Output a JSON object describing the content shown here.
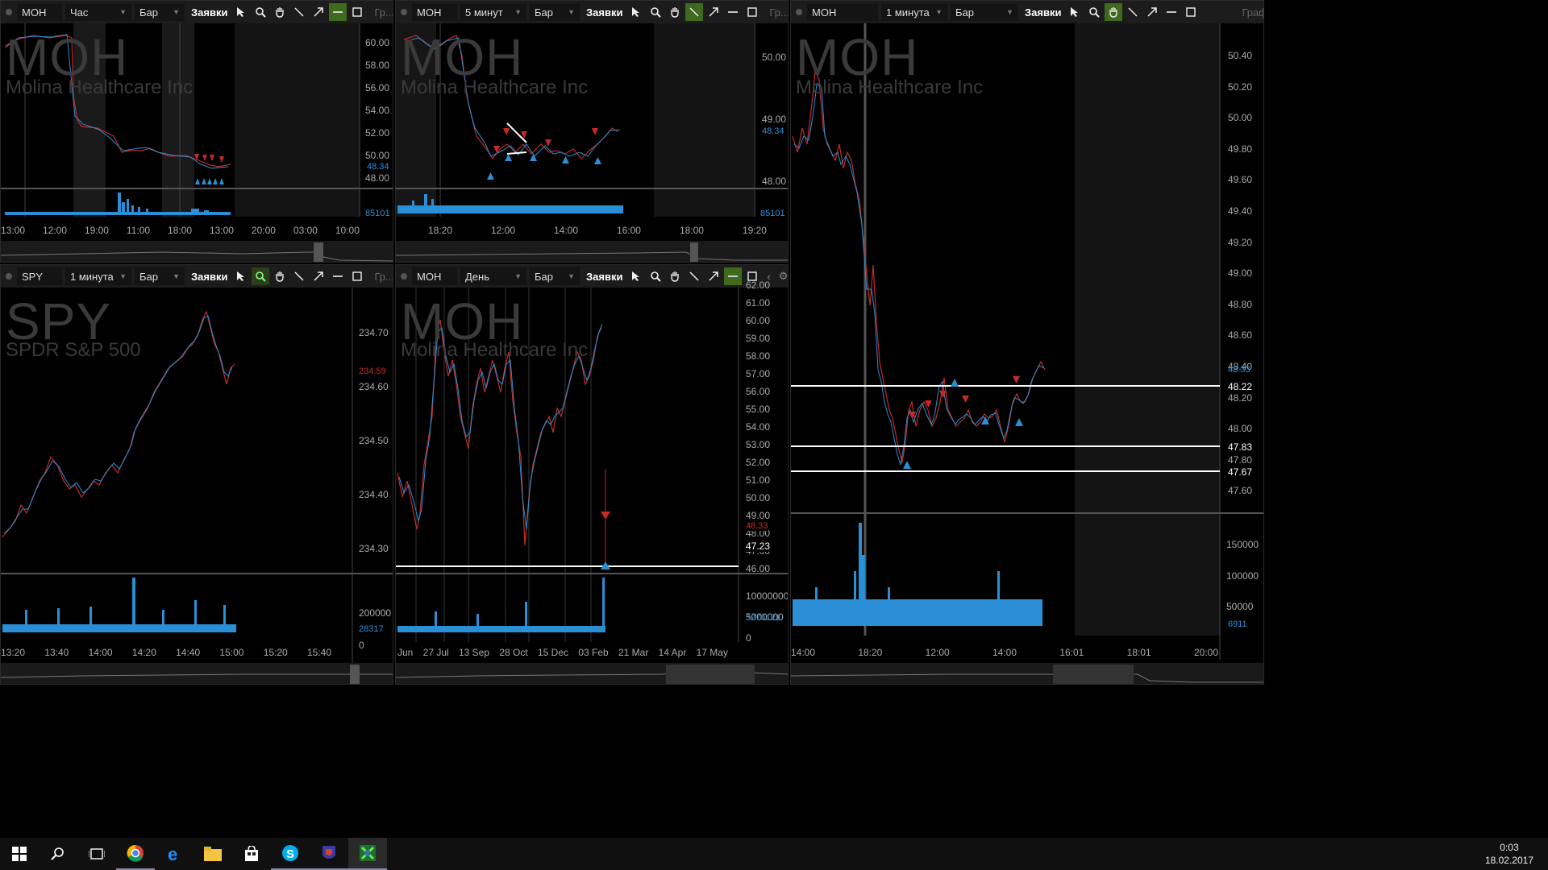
{
  "panels": [
    {
      "id": "p1",
      "symbol": "MOH",
      "interval": "Час",
      "chart_type": "Бар",
      "orders": "Заявки",
      "group": "Гр...",
      "watermark": "MOH",
      "name": "Molina Healthcare Inc",
      "price_labels": [
        "60.00",
        "58.00",
        "56.00",
        "54.00",
        "52.00",
        "50.00",
        "48.00"
      ],
      "last_price": "48.34",
      "volume_label": "85101",
      "time_labels": [
        "13:00",
        "12:00",
        "19:00",
        "11:00",
        "18:00",
        "13:00",
        "20:00",
        "03:00",
        "10:00"
      ]
    },
    {
      "id": "p2",
      "symbol": "MOH",
      "interval": "5 минут",
      "chart_type": "Бар",
      "orders": "Заявки",
      "group": "Гр...",
      "watermark": "MOH",
      "name": "Molina Healthcare Inc",
      "price_labels": [
        "50.00",
        "49.00",
        "48.00"
      ],
      "last_price": "48.34",
      "volume_label": "85101",
      "time_labels": [
        "18:20",
        "12:00",
        "14:00",
        "16:00",
        "18:00",
        "19:20"
      ]
    },
    {
      "id": "p3",
      "symbol": "MOH",
      "interval": "1 минута",
      "chart_type": "Бар",
      "orders": "Заявки",
      "group": "График",
      "watermark": "MOH",
      "name": "Molina Healthcare Inc",
      "price_labels": [
        "50.40",
        "50.20",
        "50.00",
        "49.80",
        "49.60",
        "49.40",
        "49.20",
        "49.00",
        "48.80",
        "48.60",
        "48.40",
        "48.20",
        "48.00",
        "47.80",
        "47.60"
      ],
      "last_price": "48.33",
      "levels": [
        "48.22",
        "47.83",
        "47.67"
      ],
      "volume_labels": [
        "150000",
        "100000",
        "50000"
      ],
      "volume_last": "6911",
      "time_labels": [
        "14:00",
        "18:20",
        "12:00",
        "14:00",
        "16:01",
        "18:01",
        "20:00"
      ]
    },
    {
      "id": "p4",
      "symbol": "SPY",
      "interval": "1 минута",
      "chart_type": "Бар",
      "orders": "Заявки",
      "group": "Гр...",
      "watermark": "SPY",
      "name": "SPDR S&P 500",
      "price_labels": [
        "234.70",
        "234.60",
        "234.50",
        "234.40",
        "234.30"
      ],
      "last_price": "234.59",
      "volume_labels": [
        "200000",
        "0"
      ],
      "volume_last": "28317",
      "time_labels": [
        "13:20",
        "13:40",
        "14:00",
        "14:20",
        "14:40",
        "15:00",
        "15:20",
        "15:40"
      ]
    },
    {
      "id": "p5",
      "symbol": "MOH",
      "interval": "День",
      "chart_type": "Бар",
      "orders": "Заявки",
      "group": "",
      "watermark": "MOH",
      "name": "Molina Healthcare Inc",
      "price_labels": [
        "62.00",
        "61.00",
        "60.00",
        "59.00",
        "58.00",
        "57.00",
        "56.00",
        "55.00",
        "54.00",
        "53.00",
        "52.00",
        "51.00",
        "50.00",
        "49.00",
        "48.00",
        "47.00",
        "46.00"
      ],
      "last_price": "48.33",
      "level": "47.23",
      "volume_labels": [
        "10000000",
        "5000000",
        "0"
      ],
      "volume_last": "3270121",
      "time_labels": [
        "Jun",
        "27 Jul",
        "13 Sep",
        "28 Oct",
        "15 Dec",
        "03 Feb",
        "21 Mar",
        "14 Apr",
        "17 May"
      ]
    }
  ],
  "taskbar": {
    "icons": [
      "windows-start-icon",
      "search-icon",
      "task-view-icon",
      "chrome-icon",
      "edge-icon",
      "file-explorer-icon",
      "store-icon",
      "skype-icon",
      "app-icon",
      "trading-app-icon"
    ],
    "time": "0:03",
    "date": "18.02.2017"
  },
  "colors": {
    "up": "#2a8fd6",
    "down": "#c42a2a",
    "bg": "#000000",
    "toolbar": "#1c1c1c"
  }
}
